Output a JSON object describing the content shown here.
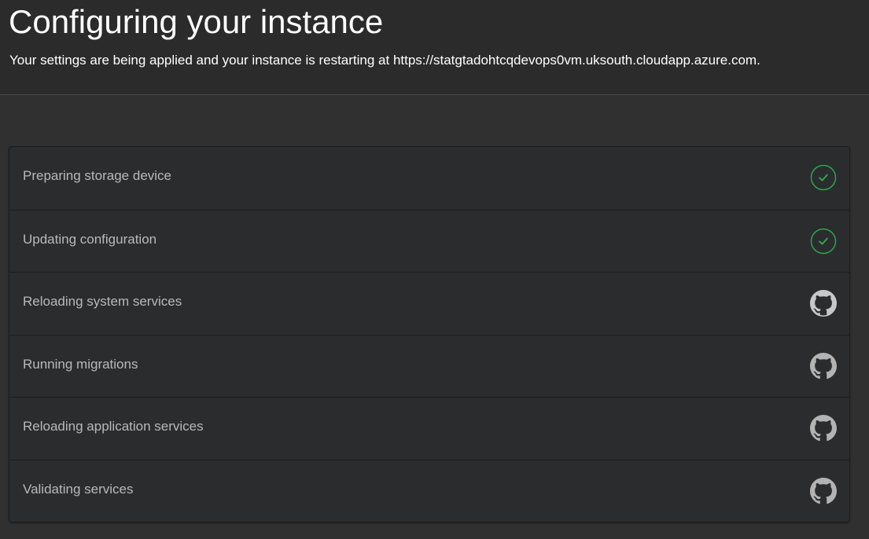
{
  "header": {
    "title": "Configuring your instance",
    "subtitle": "Your settings are being applied and your instance is restarting at https://statgtadohtcqdevops0vm.uksouth.cloudapp.azure.com."
  },
  "steps": [
    {
      "label": "Preparing storage device",
      "status": "complete",
      "icon": "check-circle-icon"
    },
    {
      "label": "Updating configuration",
      "status": "complete",
      "icon": "check-circle-icon"
    },
    {
      "label": "Reloading system services",
      "status": "in-progress",
      "icon": "github-octocat-icon"
    },
    {
      "label": "Running migrations",
      "status": "pending",
      "icon": "github-octocat-icon"
    },
    {
      "label": "Reloading application services",
      "status": "pending",
      "icon": "github-octocat-icon"
    },
    {
      "label": "Validating services",
      "status": "pending",
      "icon": "github-octocat-icon"
    }
  ],
  "colors": {
    "background": "#303030",
    "header_background": "#2b2b2b",
    "panel_background": "#2b2c2e",
    "step_text": "#b9b9b9",
    "success_green": "#2ea44f",
    "pending_icon": "#b3b3b3"
  }
}
